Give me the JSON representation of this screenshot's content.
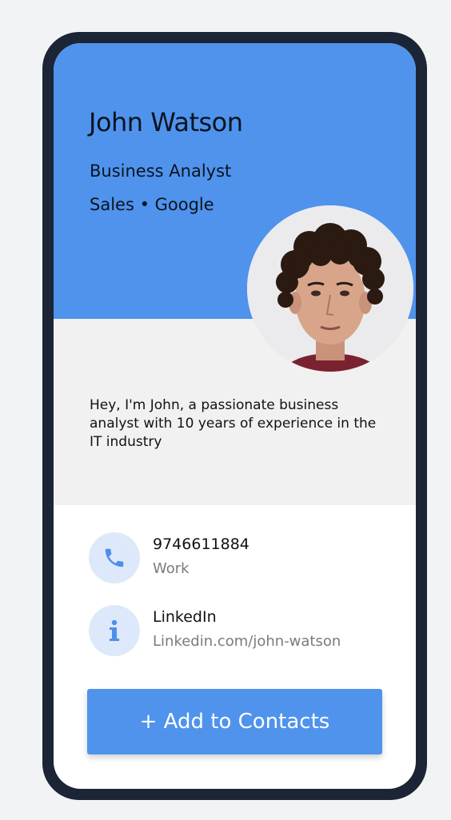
{
  "profile": {
    "name": "John Watson",
    "role": "Business Analyst",
    "company": "Sales • Google",
    "bio": "Hey, I'm John, a passionate business analyst with 10 years of experience in the IT industry",
    "avatar_icon": "person-photo"
  },
  "contacts": [
    {
      "icon": "phone-icon",
      "title": "9746611884",
      "subtitle": "Work"
    },
    {
      "icon": "info-icon",
      "title": "LinkedIn",
      "subtitle": "Linkedin.com/john-watson"
    }
  ],
  "actions": {
    "add_label": "+ Add to Contacts"
  },
  "colors": {
    "brand_blue": "#4f93ed",
    "frame": "#1b2535",
    "icon_bg": "#dde9fb",
    "bio_bg": "#f1f1f1"
  }
}
